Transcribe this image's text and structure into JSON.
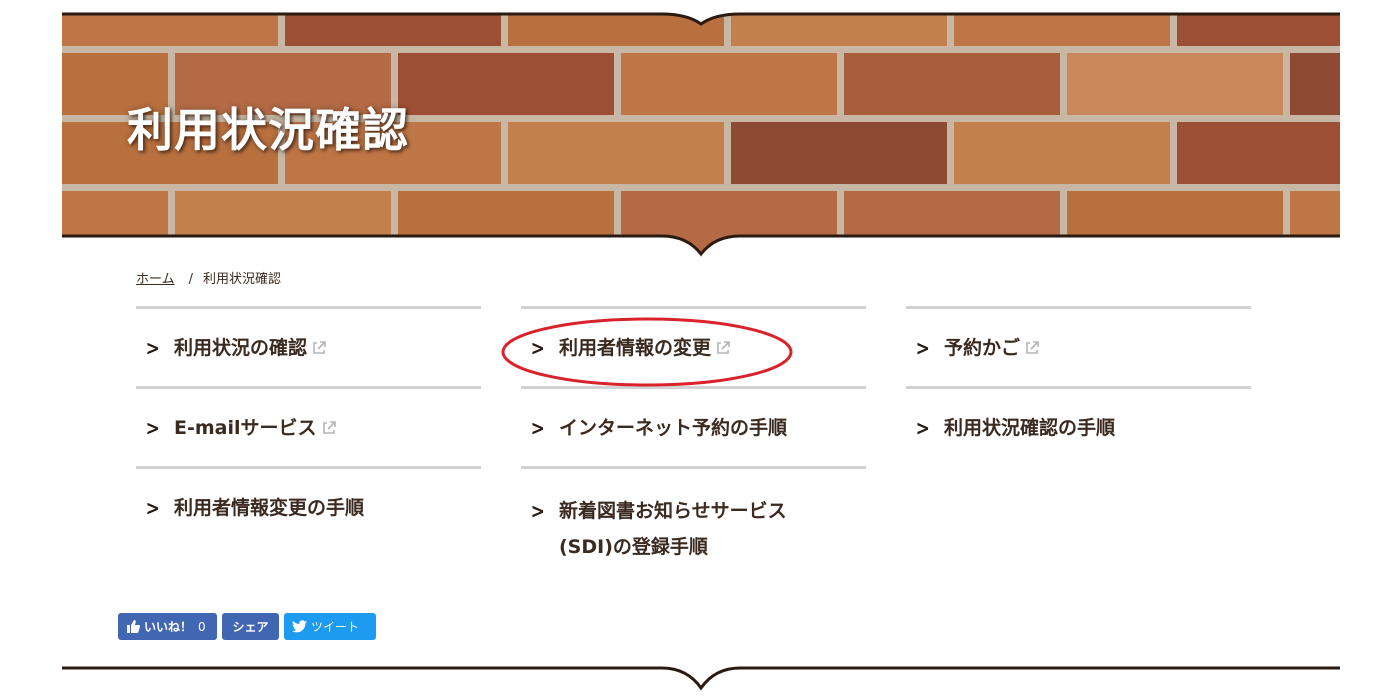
{
  "banner": {
    "title": "利用状況確認"
  },
  "breadcrumb": {
    "home": "ホーム",
    "separator": "/",
    "current": "利用状況確認"
  },
  "links": {
    "col0": [
      {
        "label": "利用状況の確認",
        "external": true
      },
      {
        "label": "E-mailサービス",
        "external": true
      },
      {
        "label": "利用者情報変更の手順",
        "external": false
      }
    ],
    "col1": [
      {
        "label": "利用者情報の変更",
        "external": true
      },
      {
        "label": "インターネット予約の手順",
        "external": false
      },
      {
        "label_line1": "新着図書お知らせサービス",
        "label_line2": "(SDI)の登録手順",
        "external": false
      }
    ],
    "col2": [
      {
        "label": "予約かご",
        "external": true
      },
      {
        "label": "利用状況確認の手順",
        "external": false
      }
    ],
    "chevron": ">"
  },
  "social": {
    "like": "いいね！",
    "like_count": "0",
    "share": "シェア",
    "tweet": "ツイート"
  },
  "colors": {
    "text": "#3a2a20",
    "divider": "#d2d2d2",
    "highlight": "#d9232b",
    "facebook": "#4267b2",
    "twitter": "#1d9bf0"
  }
}
